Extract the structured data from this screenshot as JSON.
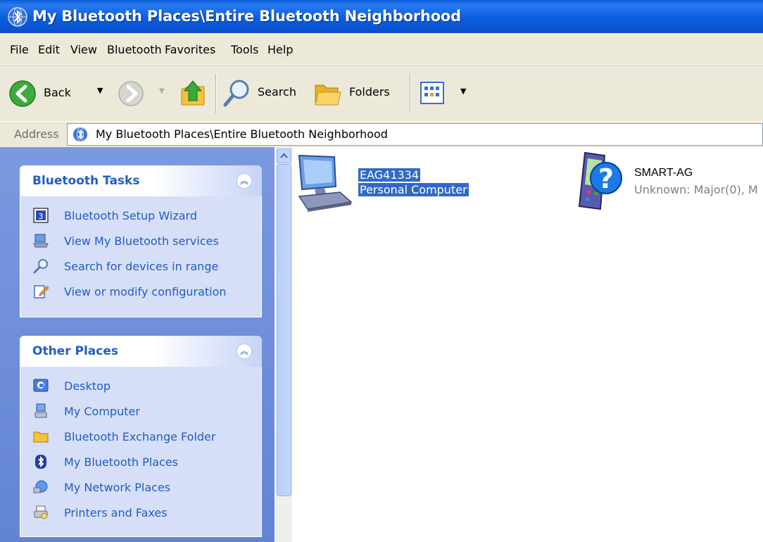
{
  "window": {
    "title": "My Bluetooth Places\\Entire Bluetooth Neighborhood"
  },
  "menu": {
    "items": [
      "File",
      "Edit",
      "View",
      "Bluetooth",
      "Favorites",
      "Tools",
      "Help"
    ]
  },
  "toolbar": {
    "back_label": "Back",
    "search_label": "Search",
    "folders_label": "Folders"
  },
  "address": {
    "label": "Address",
    "value": "My Bluetooth Places\\Entire Bluetooth Neighborhood"
  },
  "tasks_panel": {
    "title": "Bluetooth Tasks",
    "items": [
      {
        "label": "Bluetooth Setup Wizard",
        "icon": "wizard-icon"
      },
      {
        "label": "View My Bluetooth services",
        "icon": "services-icon"
      },
      {
        "label": "Search for devices in range",
        "icon": "search-icon"
      },
      {
        "label": "View or modify configuration",
        "icon": "config-icon"
      }
    ]
  },
  "places_panel": {
    "title": "Other Places",
    "items": [
      {
        "label": "Desktop",
        "icon": "desktop-icon"
      },
      {
        "label": "My Computer",
        "icon": "computer-icon"
      },
      {
        "label": "Bluetooth Exchange Folder",
        "icon": "folder-icon"
      },
      {
        "label": "My Bluetooth Places",
        "icon": "bluetooth-icon"
      },
      {
        "label": "My Network Places",
        "icon": "network-icon"
      },
      {
        "label": "Printers and Faxes",
        "icon": "printer-icon"
      }
    ]
  },
  "devices": [
    {
      "name": "EAG41334",
      "type": "Personal Computer",
      "selected": true
    },
    {
      "name": "SMART-AG",
      "type": "Unknown: Major(0), M",
      "selected": false
    }
  ],
  "colors": {
    "title_blue": "#0a5bd8",
    "link_blue": "#215dc6",
    "selection": "#316ac5",
    "pane_blue": "#6384d3"
  }
}
